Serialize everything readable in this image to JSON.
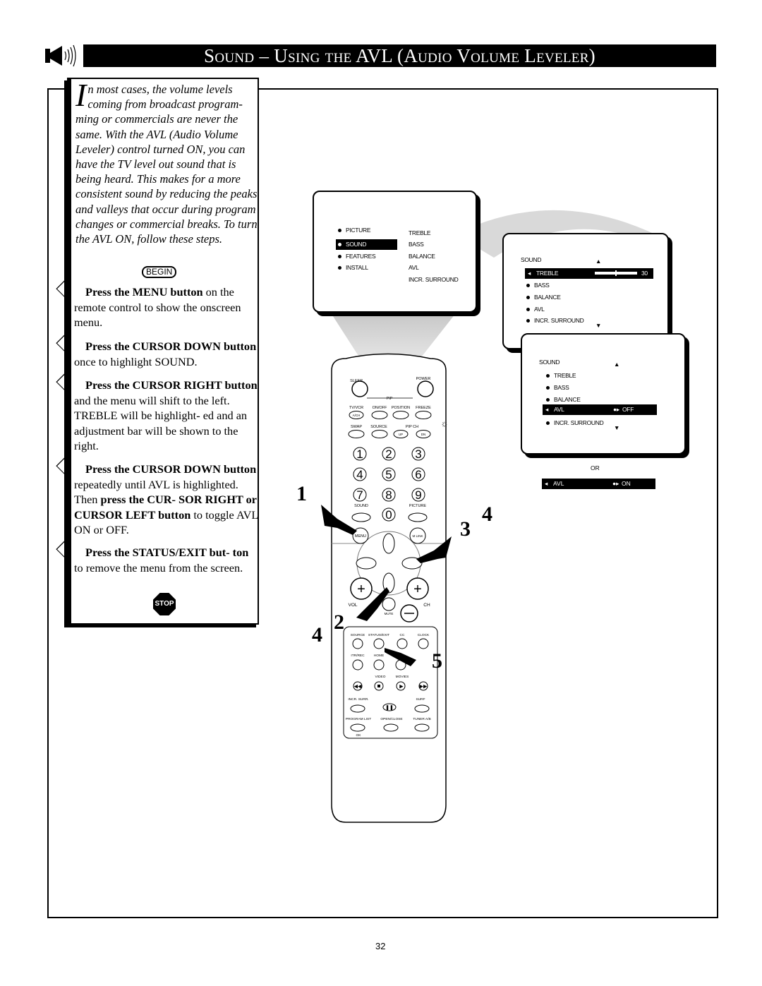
{
  "header": {
    "title": "Sound – Using the AVL (Audio Volume Leveler)",
    "icon": "speaker-icon"
  },
  "intro": {
    "dropcap": "I",
    "text": "n most cases, the volume levels coming from broadcast program- ming or commercials are never the same.  With the AVL (Audio Volume Leveler) control turned ON, you can have the TV level out sound that is being heard.  This makes for a more consistent sound by reducing the peaks and valleys that occur during program changes or commercial breaks.  To turn the AVL ON, follow these steps.",
    "begin": "BEGIN"
  },
  "steps": [
    {
      "num": "1",
      "bold": "Press the MENU button",
      "text": " on the remote control to show the onscreen menu."
    },
    {
      "num": "2",
      "bold": "Press the CURSOR DOWN button",
      "text": " once to highlight SOUND."
    },
    {
      "num": "3",
      "bold": "Press the CURSOR RIGHT button",
      "text": " and the menu will shift to the left. TREBLE will be highlight- ed and an adjustment bar will be shown to the right."
    },
    {
      "num": "4",
      "bold": "Press the CURSOR DOWN button",
      "text": " repeatedly until AVL is highlighted.  Then ",
      "bold2": "press the CUR- SOR RIGHT or CURSOR LEFT button",
      "text2": " to toggle AVL ON or OFF."
    },
    {
      "num": "5",
      "bold": "Press the STATUS/EXIT but- ton",
      "text": " to remove the menu from the screen."
    }
  ],
  "stop": "STOP",
  "main_menu": {
    "left": [
      "PICTURE",
      "SOUND",
      "FEATURES",
      "INSTALL"
    ],
    "right": [
      "TREBLE",
      "BASS",
      "BALANCE",
      "AVL",
      "INCR. SURROUND"
    ],
    "selected": "SOUND"
  },
  "sound_menu_1": {
    "title": "SOUND",
    "items": [
      "TREBLE",
      "BASS",
      "BALANCE",
      "AVL",
      "INCR. SURROUND"
    ],
    "selected": "TREBLE",
    "treble_value": "30",
    "treble_level": 0.5
  },
  "sound_menu_2": {
    "title": "SOUND",
    "items": [
      "TREBLE",
      "BASS",
      "BALANCE",
      "AVL",
      "INCR. SURROUND"
    ],
    "selected": "AVL",
    "avl_value": "OFF"
  },
  "or_label": "OR",
  "avl_on": {
    "label": "AVL",
    "value": "ON"
  },
  "remote": {
    "sleep": "SLEEP",
    "power": "POWER",
    "pip": "PIP",
    "row1": [
      "TV/VCR",
      "ON/OFF",
      "POSITION",
      "FREEZE"
    ],
    "ach": "A/CH",
    "row2": [
      "SWAP",
      "SOURCE",
      "PIP CH"
    ],
    "up": "UP",
    "dn": "DN",
    "digits": [
      "1",
      "2",
      "3",
      "4",
      "5",
      "6",
      "7",
      "8",
      "9",
      "0"
    ],
    "sound": "SOUND",
    "picture": "PICTURE",
    "menu": "MENU",
    "mlink": "M LINK",
    "vol": "VOL",
    "ch": "CH",
    "mute": "MUTE",
    "row3": [
      "SOURCE",
      "STATUS/EXIT",
      "CC",
      "CLOCK"
    ],
    "row4": [
      "ITR/REC",
      "HOME"
    ],
    "row5": [
      "VIDEO",
      "MOVIES"
    ],
    "incr": "INCR. SURR.",
    "surf": "SURF",
    "row6": [
      "PROGRAM LIST",
      "OPEN/CLOSE",
      "TUNER A/B"
    ],
    "ok": "OK"
  },
  "callouts": [
    "1",
    "3",
    "4",
    "4",
    "2",
    "5"
  ],
  "page_number": "32"
}
